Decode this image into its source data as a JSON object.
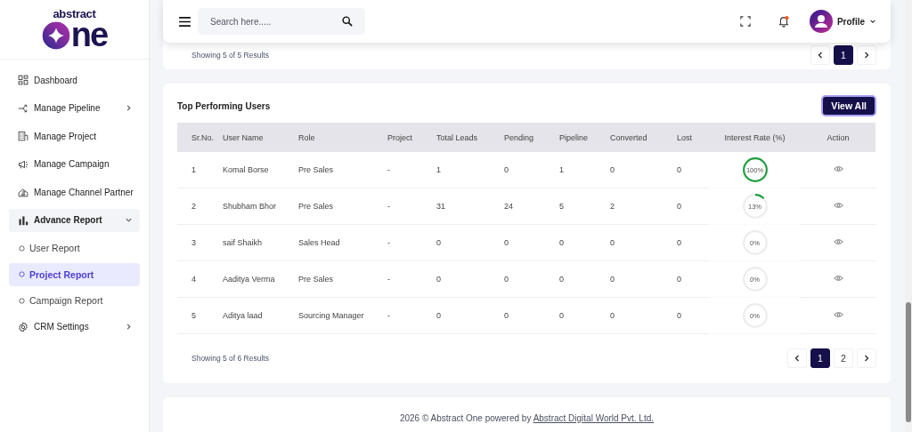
{
  "logo": {
    "top": "abstract",
    "bottom": "ne"
  },
  "sidebar": {
    "items": [
      {
        "label": "Dashboard",
        "selected": false,
        "expanded": false,
        "has_arrow": false
      },
      {
        "label": "Manage Pipeline",
        "selected": false,
        "expanded": false,
        "has_arrow": true
      },
      {
        "label": "Manage Project",
        "selected": false,
        "expanded": false,
        "has_arrow": false
      },
      {
        "label": "Manage Campaign",
        "selected": false,
        "expanded": false,
        "has_arrow": false
      },
      {
        "label": "Manage Channel Partner",
        "selected": false,
        "expanded": false,
        "has_arrow": false
      },
      {
        "label": "Advance Report",
        "selected": false,
        "expanded": true,
        "has_arrow": true,
        "children": [
          {
            "label": "User Report",
            "selected": false
          },
          {
            "label": "Project Report",
            "selected": true
          },
          {
            "label": "Campaign Report",
            "selected": false
          }
        ]
      },
      {
        "label": "CRM Settings",
        "selected": false,
        "expanded": false,
        "has_arrow": true
      }
    ]
  },
  "header": {
    "search": {
      "placeholder": "Search here....."
    },
    "profile": {
      "label": "Profile"
    },
    "notification": {
      "unread": true
    }
  },
  "top_card": {
    "results": "Showing 5 of 5 Results",
    "pages": [
      {
        "label": "1",
        "selected": true
      }
    ]
  },
  "users_card": {
    "title": "Top Performing Users",
    "view_all": "View All",
    "table": {
      "columns": [
        "Sr.No.",
        "User Name",
        "Role",
        "Project",
        "Total Leads",
        "Pending",
        "Pipeline",
        "Converted",
        "Lost",
        "Interest Rate (%)",
        "Action"
      ],
      "rows": [
        {
          "cells": [
            "1",
            "Komal Borse",
            "Pre Sales",
            "-",
            "1",
            "0",
            "1",
            "0",
            "0"
          ],
          "interest": "100%",
          "level": 1
        },
        {
          "cells": [
            "2",
            "Shubham Bhor",
            "Pre Sales",
            "-",
            "31",
            "24",
            "5",
            "2",
            "0"
          ],
          "interest": "13%",
          "level": 0.13
        },
        {
          "cells": [
            "3",
            "saif Shaikh",
            "Sales Head",
            "-",
            "0",
            "0",
            "0",
            "0",
            "0"
          ],
          "interest": "0%",
          "level": 0
        },
        {
          "cells": [
            "4",
            "Aaditya Verma",
            "Pre Sales",
            "-",
            "0",
            "0",
            "0",
            "0",
            "0"
          ],
          "interest": "0%",
          "level": 0
        },
        {
          "cells": [
            "5",
            "Aditya laad",
            "Sourcing Manager",
            "-",
            "0",
            "0",
            "0",
            "0",
            "0"
          ],
          "interest": "0%",
          "level": 0
        }
      ]
    },
    "results": "Showing 5 of 6 Results",
    "pages": [
      {
        "label": "1",
        "selected": true
      },
      {
        "label": "2",
        "selected": false
      }
    ]
  },
  "footer": {
    "text": "2026 © Abstract One powered by",
    "link": "Abstract Digital World Pvt. Ltd."
  }
}
